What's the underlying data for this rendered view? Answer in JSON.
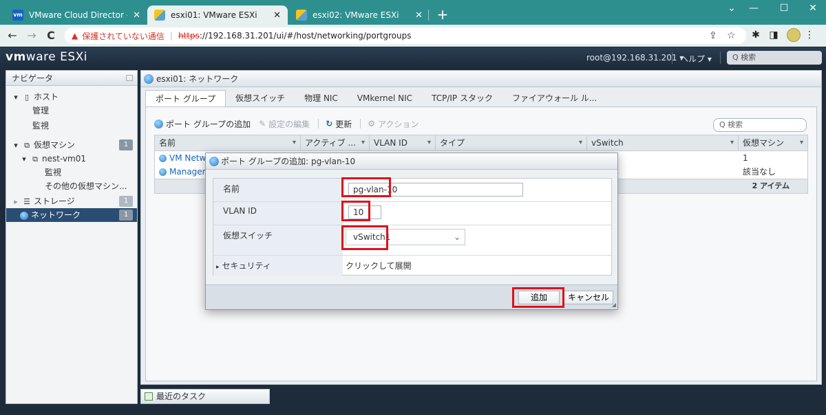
{
  "browser": {
    "tabs": [
      {
        "title": "VMware Cloud Director - vApp -",
        "close": "✕",
        "icon": "vmware-favicon"
      },
      {
        "title": "esxi01: VMware ESXi",
        "close": "✕",
        "icon": "esxi-favicon"
      },
      {
        "title": "esxi02: VMware ESXi",
        "close": "✕",
        "icon": "esxi-favicon"
      }
    ],
    "new_tab": "+",
    "window_controls": [
      "⌄",
      "—",
      "☐",
      "✕"
    ],
    "nav": {
      "back": "←",
      "forward": "→",
      "reload": "C"
    },
    "address": {
      "warning": "保護されていない通信",
      "scheme": "https",
      "rest": "://192.168.31.201/ui/#/host/networking/portgroups"
    }
  },
  "esxi_header": {
    "brand_a": "vm",
    "brand_b": "ware",
    "brand_c": " ESXi",
    "user": "root@192.168.31.201 ▾",
    "help": "ヘルプ ▾",
    "search_placeholder": "Q 検索"
  },
  "navigator": {
    "title": "ナビゲータ",
    "items": [
      {
        "label": "ホスト"
      },
      {
        "label": "管理"
      },
      {
        "label": "監視"
      },
      {
        "label": "仮想マシン",
        "badge": "1"
      },
      {
        "label": "nest-vm01"
      },
      {
        "label": "監視"
      },
      {
        "label": "その他の仮想マシン..."
      },
      {
        "label": "ストレージ",
        "badge": "1"
      },
      {
        "label": "ネットワーク",
        "badge": "1"
      }
    ]
  },
  "main": {
    "title": "esxi01: ネットワーク",
    "tabs": [
      "ポート グループ",
      "仮想スイッチ",
      "物理 NIC",
      "VMkernel NIC",
      "TCP/IP スタック",
      "ファイアウォール ル..."
    ],
    "actions": {
      "add": "ポート グループの追加",
      "edit": "設定の編集",
      "refresh": "更新",
      "actions": "アクション"
    },
    "filter_placeholder": "Q 検索",
    "columns": [
      "名前",
      "アクティブ ...",
      "VLAN ID",
      "タイプ",
      "vSwitch",
      "仮想マシン"
    ],
    "rows": [
      {
        "name": "VM Network",
        "vswitch": "itch0",
        "vms": "1"
      },
      {
        "name": "Management Network",
        "vswitch": "itch0",
        "vms": "該当なし"
      }
    ],
    "footer": "2 アイテム"
  },
  "tasks": {
    "label": "最近のタスク"
  },
  "dialog": {
    "title": "ポート グループの追加: pg-vlan-10",
    "fields": {
      "name_label": "名前",
      "name_value": "pg-vlan-10",
      "vlan_label": "VLAN ID",
      "vlan_value": "10",
      "vswitch_label": "仮想スイッチ",
      "vswitch_value": "vSwitch1",
      "security_label": "セキュリティ",
      "security_value": "クリックして展開"
    },
    "buttons": {
      "add": "追加",
      "cancel": "キャンセル"
    }
  },
  "colors": {
    "browser_tabstrip": "#2e8f8f",
    "esxi_header": "#1d2b3a",
    "nav_selected": "#2a4d73",
    "highlight": "#e0101a",
    "link": "#1565c0"
  }
}
